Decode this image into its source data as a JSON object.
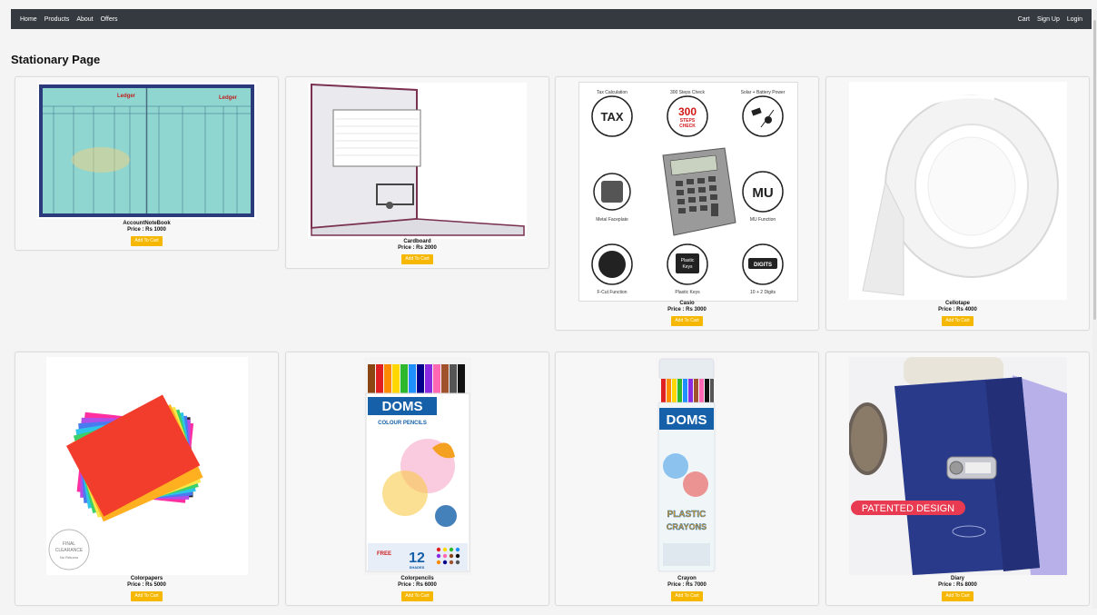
{
  "nav": {
    "left": [
      "Home",
      "Products",
      "About",
      "Offers"
    ],
    "right": [
      "Cart",
      "Sign Up",
      "Login"
    ]
  },
  "page": {
    "title": "Stationary Page"
  },
  "button_label": "Add To Cart",
  "products": [
    {
      "name": "AccountNoteBook",
      "price": "Price : Rs 1000"
    },
    {
      "name": "Cardboard",
      "price": "Price : Rs 2000"
    },
    {
      "name": "Casio",
      "price": "Price : Rs 3000"
    },
    {
      "name": "Cellotape",
      "price": "Price : Rs 4000"
    },
    {
      "name": "Colorpapers",
      "price": "Price : Rs 5000"
    },
    {
      "name": "Colorpencils",
      "price": "Price : Rs 6000"
    },
    {
      "name": "Crayon",
      "price": "Price : Rs 7000"
    },
    {
      "name": "Diary",
      "price": "Price : Rs 8000"
    }
  ],
  "image_text": {
    "ledger": [
      "Ledger",
      "Ledger"
    ],
    "casio": {
      "features": [
        "Tax Calculation",
        "300 Steps Check",
        "Solar + Battery Power",
        "Metal Faceplate",
        "MU Function",
        "F-Cut Function",
        "Plastic Keys",
        "10 + 2 Digits"
      ],
      "badges": [
        "TAX",
        "300",
        "STEPS",
        "CHECK",
        "MU",
        "Plastic",
        "Keys",
        "DIGITS"
      ]
    },
    "colorpapers_stamp": [
      "FINAL",
      "CLEARANCE",
      "No Returns"
    ],
    "doms_pencils": [
      "DOMS",
      "COLOUR PENCILS",
      "12",
      "SHADES",
      "FREE"
    ],
    "doms_crayons": [
      "DOMS",
      "PLASTIC",
      "CRAYONS"
    ],
    "diary_banner": "PATENTED DESIGN"
  },
  "colors": {
    "nav_bg": "#343a40",
    "button": "#f5b700"
  }
}
